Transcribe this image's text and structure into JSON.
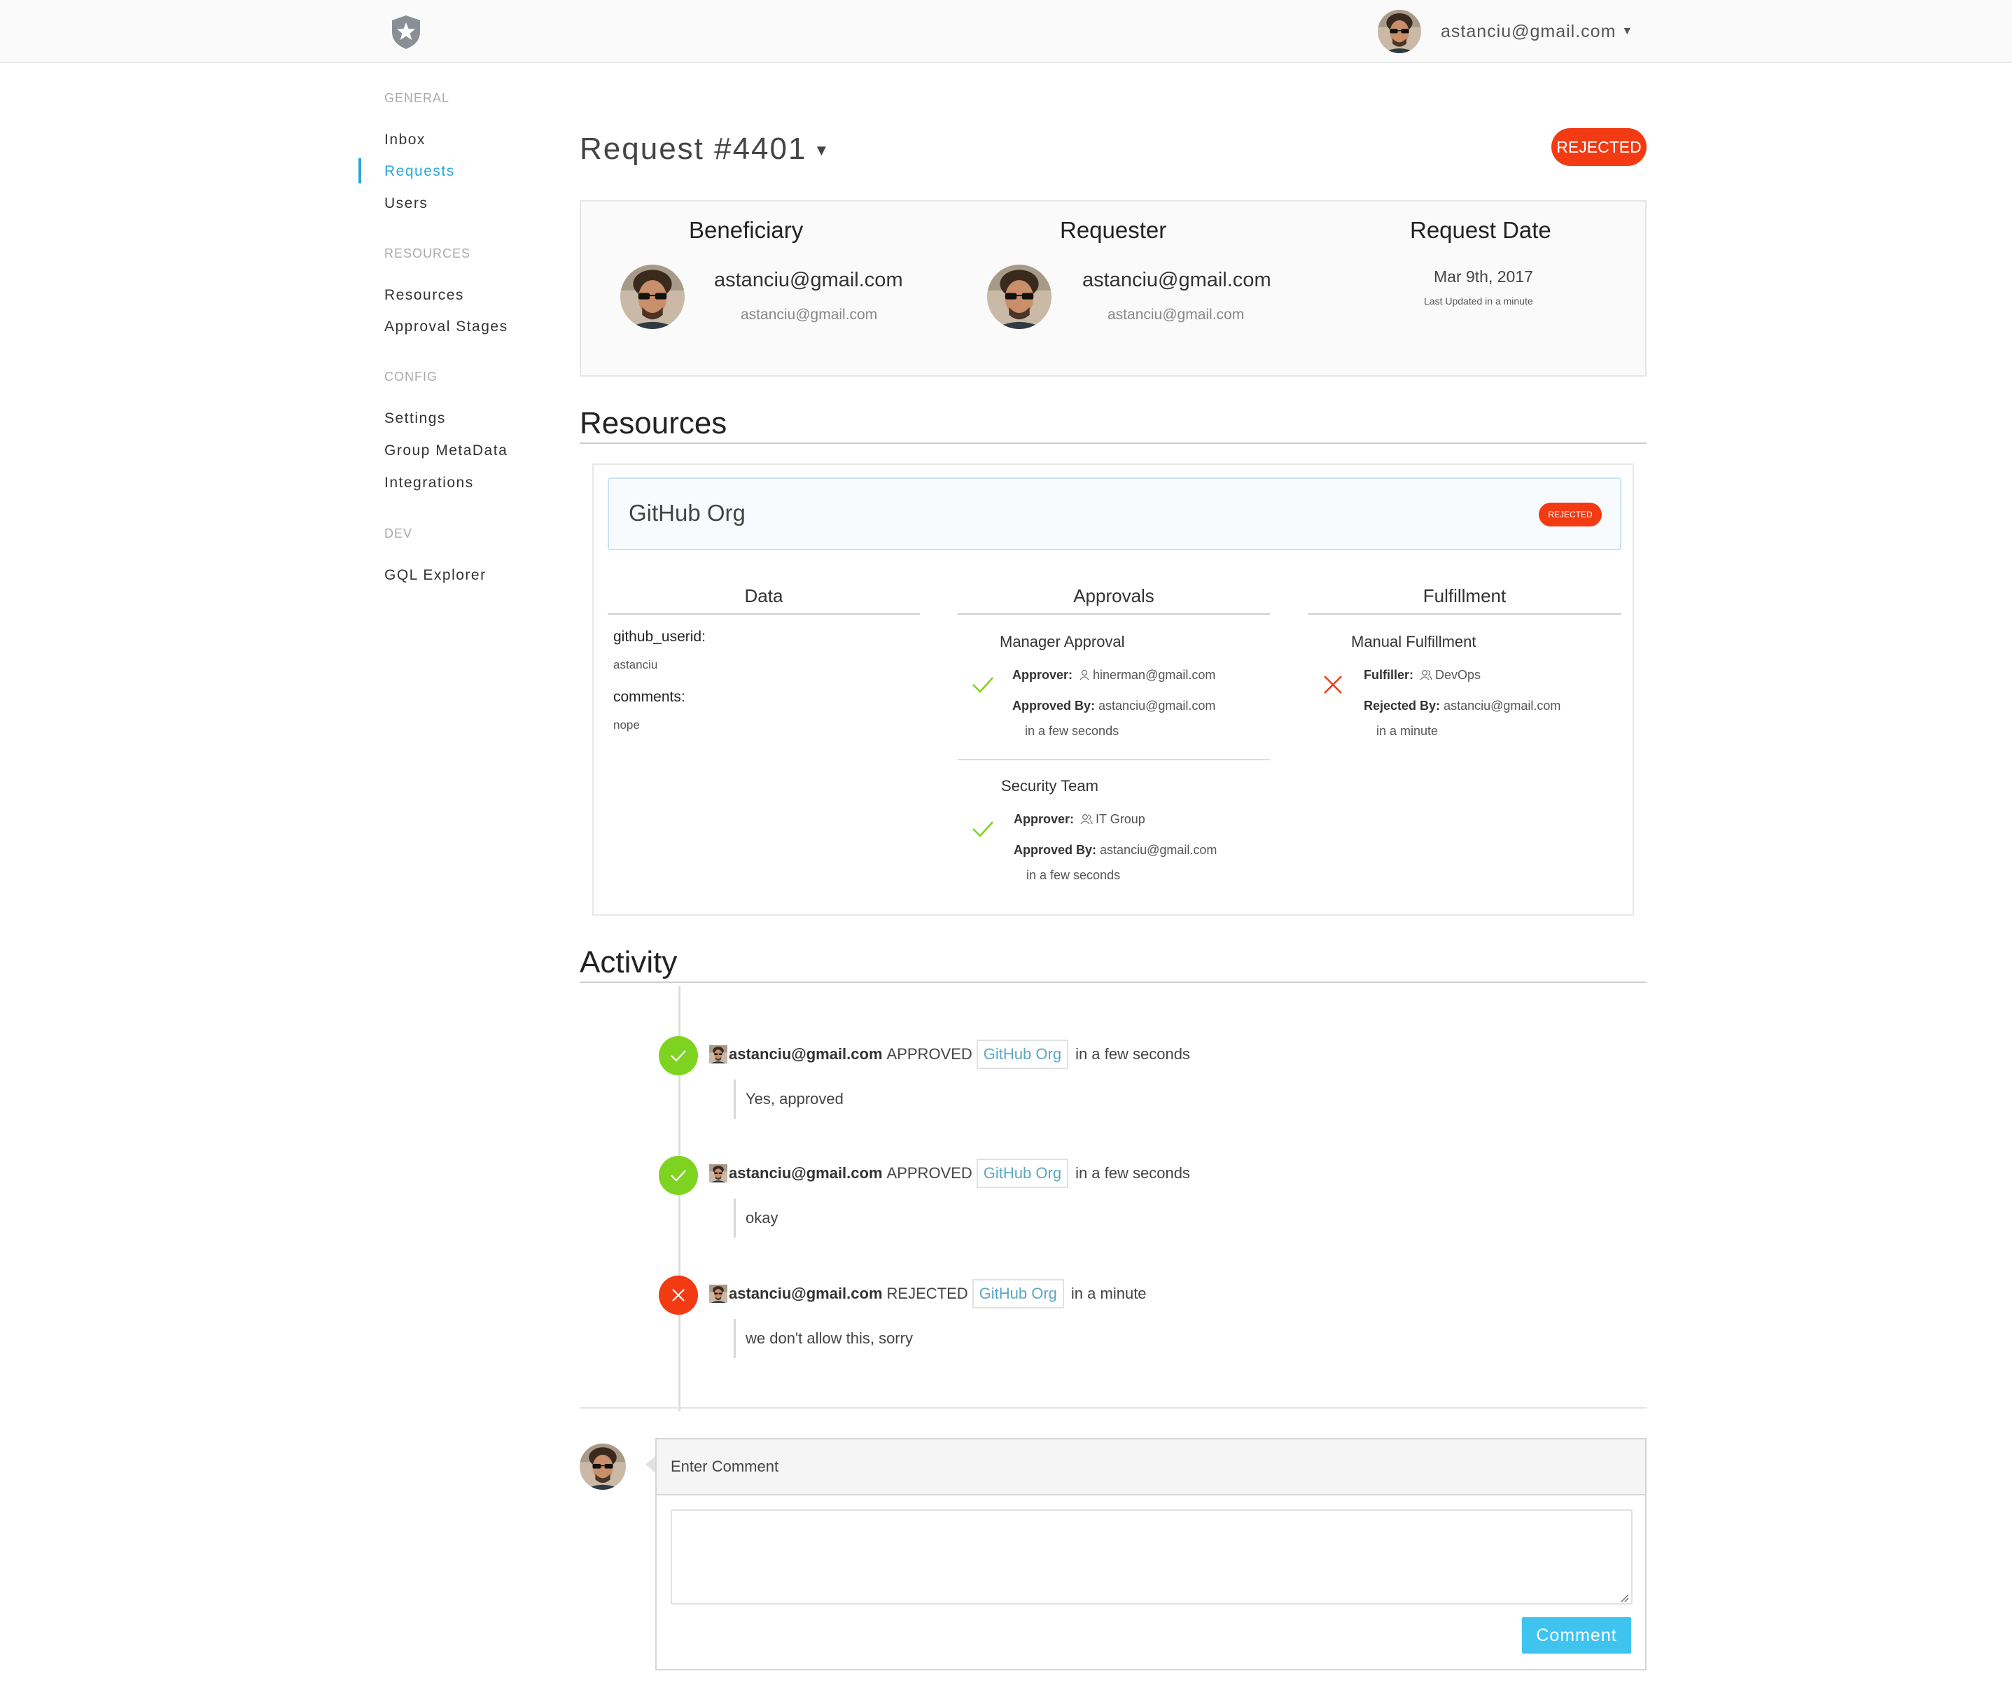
{
  "header": {
    "logo_icon": "shield-star-icon",
    "user_email": "astanciu@gmail.com"
  },
  "sidebar": {
    "sections": [
      {
        "title": "GENERAL",
        "items": [
          {
            "label": "Inbox"
          },
          {
            "label": "Requests",
            "active": true
          },
          {
            "label": "Users"
          }
        ]
      },
      {
        "title": "RESOURCES",
        "items": [
          {
            "label": "Resources"
          },
          {
            "label": "Approval Stages"
          }
        ]
      },
      {
        "title": "CONFIG",
        "items": [
          {
            "label": "Settings"
          },
          {
            "label": "Group MetaData"
          },
          {
            "label": "Integrations"
          }
        ]
      },
      {
        "title": "DEV",
        "items": [
          {
            "label": "GQL Explorer"
          }
        ]
      }
    ]
  },
  "request": {
    "title": "Request #4401",
    "status": "REJECTED",
    "beneficiary": {
      "heading": "Beneficiary",
      "name": "astanciu@gmail.com",
      "email": "astanciu@gmail.com"
    },
    "requester": {
      "heading": "Requester",
      "name": "astanciu@gmail.com",
      "email": "astanciu@gmail.com"
    },
    "date": {
      "heading": "Request Date",
      "value": "Mar 9th, 2017",
      "updated": "Last Updated in a minute"
    }
  },
  "resources_section": {
    "title": "Resources",
    "resource": {
      "name": "GitHub Org",
      "status": "REJECTED",
      "columns": {
        "data": "Data",
        "approvals": "Approvals",
        "fulfillment": "Fulfillment"
      },
      "data_fields": [
        {
          "key": "github_userid:",
          "value": "astanciu"
        },
        {
          "key": "comments:",
          "value": "nope"
        }
      ],
      "approvals": [
        {
          "title": "Manager Approval",
          "approver_label": "Approver:",
          "approver": "hinerman@gmail.com",
          "by_label": "Approved By:",
          "by": "astanciu@gmail.com",
          "when": "in a few seconds",
          "status_icon": "check-icon"
        },
        {
          "title": "Security Team",
          "approver_label": "Approver:",
          "approver": "IT Group",
          "by_label": "Approved By:",
          "by": "astanciu@gmail.com",
          "when": "in a few seconds",
          "status_icon": "check-icon"
        }
      ],
      "fulfillment": {
        "title": "Manual Fulfillment",
        "fulfiller_label": "Fulfiller:",
        "fulfiller": "DevOps",
        "by_label": "Rejected By:",
        "by": "astanciu@gmail.com",
        "when": "in a minute",
        "status_icon": "x-icon"
      }
    }
  },
  "activity": {
    "title": "Activity",
    "items": [
      {
        "user": "astanciu@gmail.com",
        "action": "APPROVED",
        "resource": "GitHub Org",
        "when": "in a few seconds",
        "comment": "Yes, approved",
        "kind": "approved"
      },
      {
        "user": "astanciu@gmail.com",
        "action": "APPROVED",
        "resource": "GitHub Org",
        "when": "in a few seconds",
        "comment": "okay",
        "kind": "approved"
      },
      {
        "user": "astanciu@gmail.com",
        "action": "REJECTED",
        "resource": "GitHub Org",
        "when": "in a minute",
        "comment": "we don't allow this, sorry",
        "kind": "rejected"
      }
    ]
  },
  "comment_form": {
    "heading": "Enter Comment",
    "value": "",
    "button": "Comment"
  },
  "colors": {
    "accent": "#2aa7d6",
    "rejected": "#f23b13",
    "approved": "#7ed321",
    "button": "#3fc4f0"
  }
}
